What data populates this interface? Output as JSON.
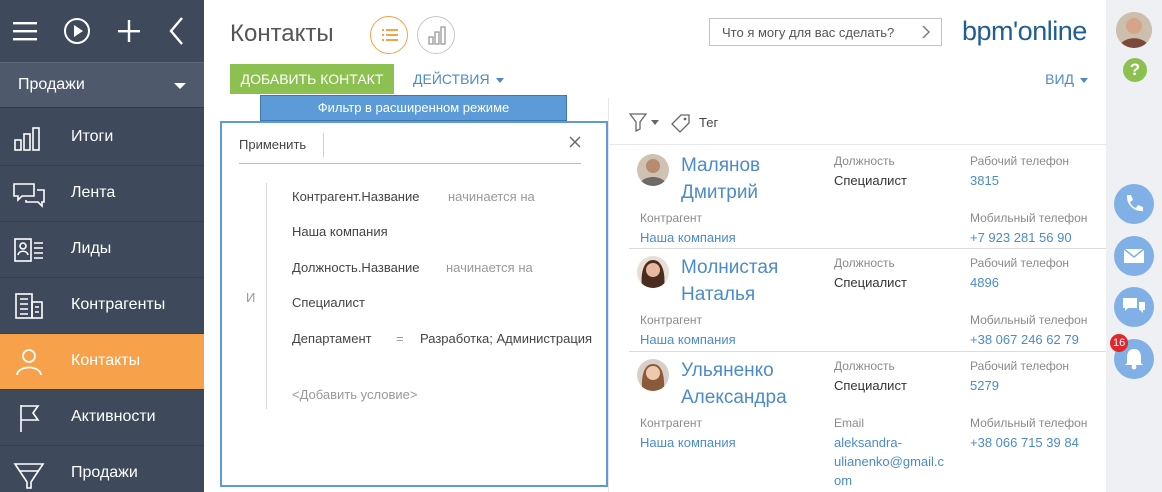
{
  "sidebar": {
    "workspace": "Продажи",
    "items": [
      {
        "label": "Итоги",
        "icon": "bar-chart-icon",
        "active": false
      },
      {
        "label": "Лента",
        "icon": "chat-bubbles-icon",
        "active": false
      },
      {
        "label": "Лиды",
        "icon": "lead-card-icon",
        "active": false
      },
      {
        "label": "Контрагенты",
        "icon": "building-icon",
        "active": false
      },
      {
        "label": "Контакты",
        "icon": "person-icon",
        "active": true
      },
      {
        "label": "Активности",
        "icon": "flag-icon",
        "active": false
      },
      {
        "label": "Продажи",
        "icon": "funnel-icon",
        "active": false
      }
    ]
  },
  "header": {
    "title": "Контакты",
    "search_placeholder": "Что я могу для вас сделать?",
    "logo": "bpm'online",
    "add_button": "ДОБАВИТЬ КОНТАКТ",
    "actions": "ДЕЙСТВИЯ",
    "view": "ВИД"
  },
  "filter": {
    "tab": "Фильтр в расширенном режиме",
    "apply": "Применить",
    "operator": "И",
    "conditions": [
      {
        "field": "Контрагент.Название",
        "comparison": "начинается на",
        "value": "Наша компания"
      },
      {
        "field": "Должность.Название",
        "comparison": "начинается на",
        "value": "Специалист"
      },
      {
        "field": "Департамент",
        "comparison": "=",
        "value": "Разработка; Администрация"
      }
    ],
    "add_condition": "<Добавить условие>"
  },
  "list": {
    "tag_label": "Тег",
    "contacts": [
      {
        "first_line": "Малянов",
        "second_line": "Дмитрий",
        "position_label": "Должность",
        "position": "Специалист",
        "phone_label": "Рабочий телефон",
        "phone": "3815",
        "account_label": "Контрагент",
        "account": "Наша компания",
        "mobile_label": "Мобильный телефон",
        "mobile": "+7 923 281 56 90"
      },
      {
        "first_line": "Молнистая",
        "second_line": "Наталья",
        "position_label": "Должность",
        "position": "Специалист",
        "phone_label": "Рабочий телефон",
        "phone": "4896",
        "account_label": "Контрагент",
        "account": "Наша компания",
        "mobile_label": "Мобильный телефон",
        "mobile": "+38 067 246 62 79"
      },
      {
        "first_line": "Ульяненко",
        "second_line": "Александра",
        "position_label": "Должность",
        "position": "Специалист",
        "phone_label": "Рабочий телефон",
        "phone": "5279",
        "account_label": "Контрагент",
        "account": "Наша компания",
        "email_label": "Email",
        "email_1": "aleksandra-",
        "email_2": "ulianenko@gmail.c",
        "email_3": "om",
        "mobile_label": "Мобильный телефон",
        "mobile": "+38 066 715 39 84"
      }
    ]
  },
  "rail": {
    "help": "?",
    "notifications_count": "16"
  },
  "colors": {
    "sidebar": "#3e4a5c",
    "active": "#f7a14a",
    "accent": "#4c8bc9",
    "add_button": "#8cc152",
    "filter_border": "#5d9bd8",
    "rail_button": "#80b0e6",
    "badge": "#e2262b"
  }
}
